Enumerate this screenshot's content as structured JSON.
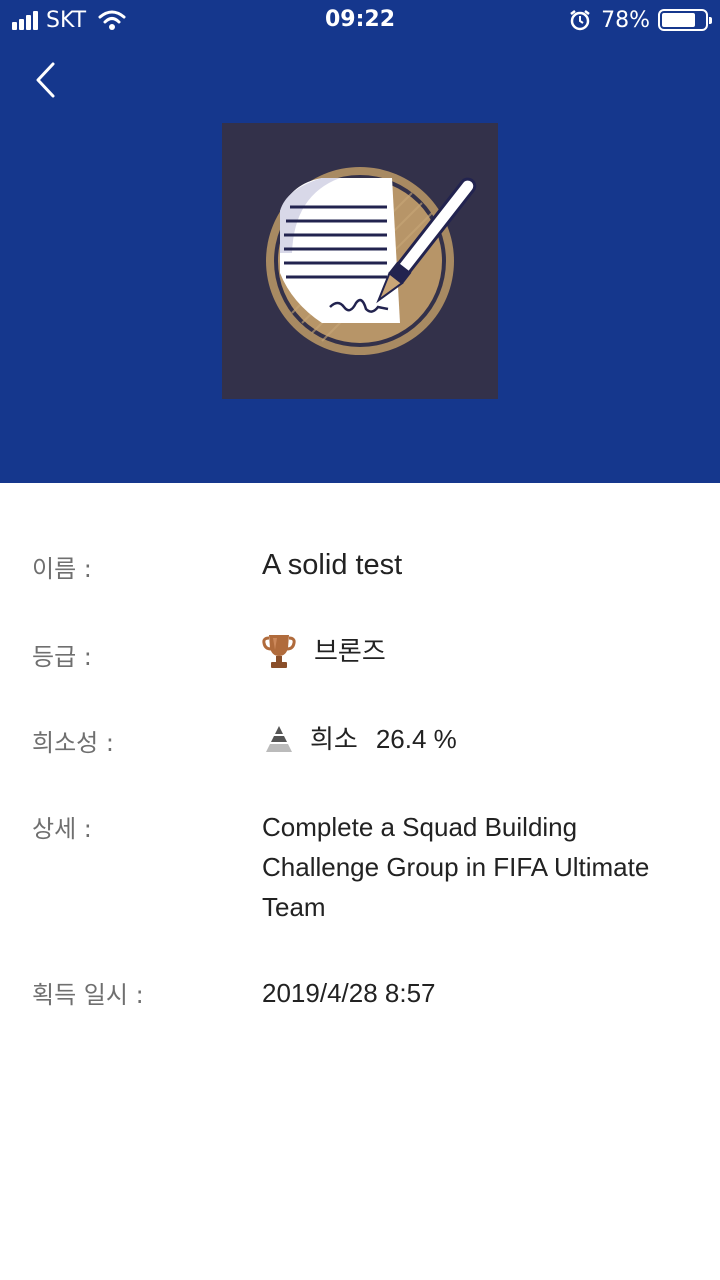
{
  "status_bar": {
    "carrier": "SKT",
    "time": "09:22",
    "battery": "78%",
    "battery_level": 0.78,
    "icons": [
      "signal-icon",
      "wifi-icon",
      "alarm-icon",
      "battery-icon"
    ]
  },
  "header": {
    "background_color": "#15378d",
    "back_icon": "chevron-left-icon",
    "trophy_image": "document-signing-pen-badge"
  },
  "details": {
    "name": {
      "label": "이름 :",
      "value": "A solid test"
    },
    "grade": {
      "label": "등급 :",
      "value": "브론즈",
      "icon": "bronze-trophy-icon"
    },
    "rarity": {
      "label": "희소성 :",
      "value": "희소",
      "percent": "26.4 %",
      "icon": "rarity-pyramid-icon"
    },
    "detail": {
      "label": "상세 :",
      "value": "Complete a Squad Building Challenge Group in FIFA Ultimate Team"
    },
    "acquired": {
      "label": "획득 일시 :",
      "value": "2019/4/28 8:57"
    }
  }
}
